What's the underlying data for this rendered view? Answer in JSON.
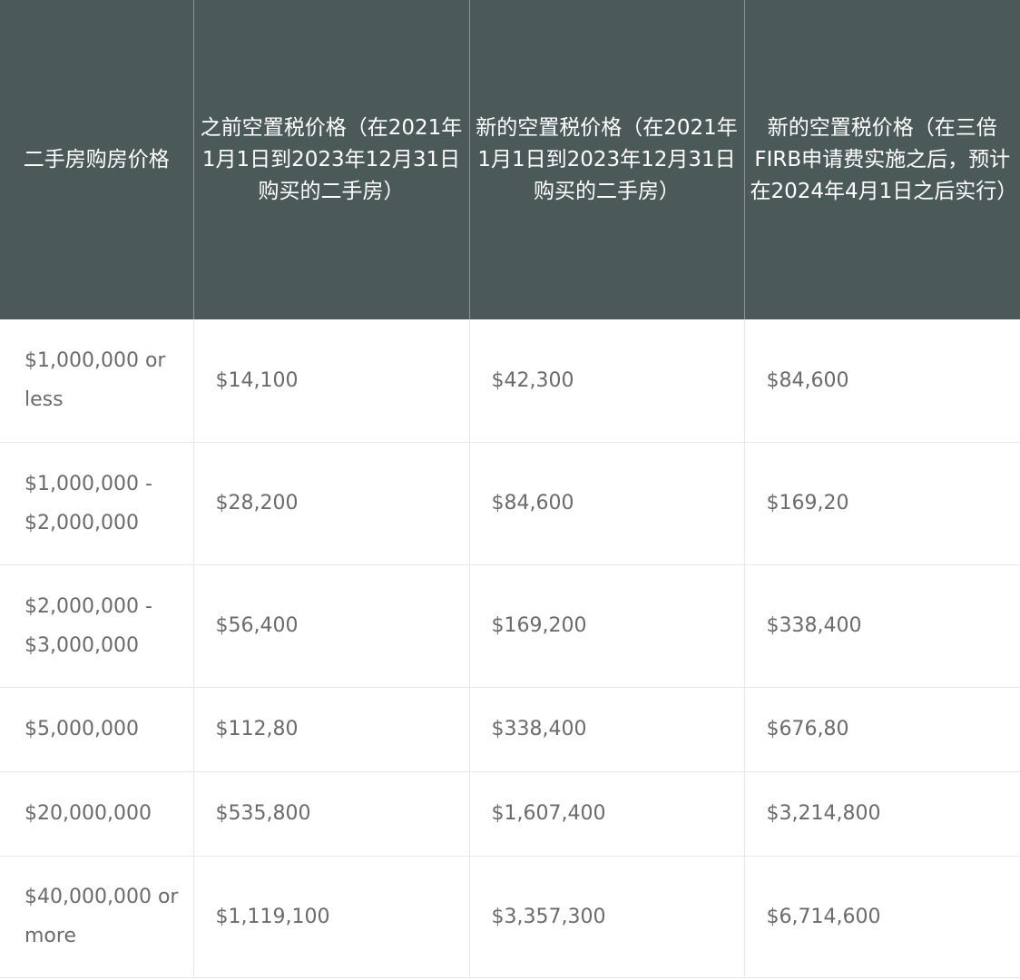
{
  "table": {
    "headers": [
      "二手房购房价格",
      "之前空置税价格（在2021年1月1日到2023年12月31日购买的二手房）",
      "新的空置税价格（在2021年1月1日到2023年12月31日购买的二手房）",
      "新的空置税价格（在三倍FIRB申请费实施之后，预计在2024年4月1日之后实行）"
    ],
    "rows": [
      [
        "$1,000,000 or less",
        "$14,100",
        "$42,300",
        "$84,600"
      ],
      [
        "$1,000,000 - $2,000,000",
        "$28,200",
        "$84,600",
        "$169,20"
      ],
      [
        "$2,000,000 - $3,000,000",
        "$56,400",
        "$169,200",
        "$338,400"
      ],
      [
        "$5,000,000",
        "$112,80",
        "$338,400",
        "$676,80"
      ],
      [
        "$20,000,000",
        "$535,800",
        "$1,607,400",
        "$3,214,800"
      ],
      [
        "$40,000,000 or more",
        "$1,119,100",
        "$3,357,300",
        "$6,714,600"
      ]
    ]
  },
  "colors": {
    "header_bg": "#4b5a58",
    "header_text": "#ffffff",
    "cell_text": "#6b6b6b",
    "grid_line": "#e8e8e8"
  }
}
